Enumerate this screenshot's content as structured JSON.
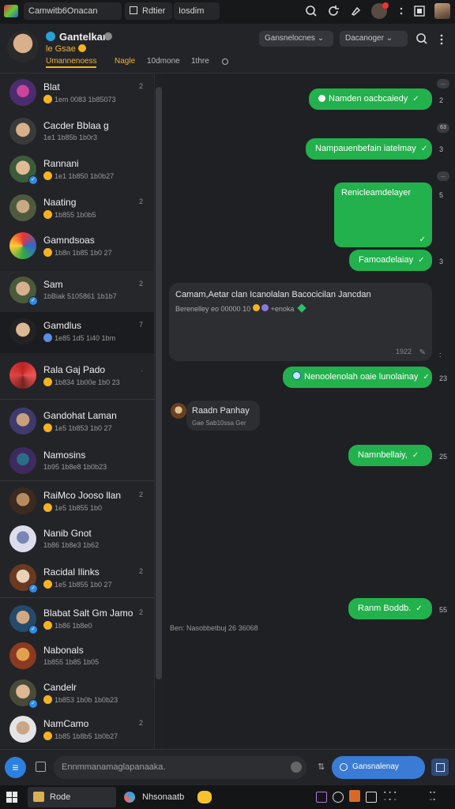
{
  "browser": {
    "tabs": [
      {
        "label": "Camwitb6Onacan"
      },
      {
        "label": "Rdtier"
      },
      {
        "label": "Iosdim"
      }
    ],
    "icons": [
      "search-icon",
      "refresh-icon",
      "pin-icon",
      "notification-icon",
      "more-icon",
      "window-icon"
    ]
  },
  "header": {
    "name": "Gantelkan",
    "status_emoji": "le Gsae",
    "subtabs": [
      "Umannenoess",
      "Nagle",
      "10dmone",
      "1thre"
    ],
    "pill1": "Gansnelocnes",
    "pill2": "Dacanoger"
  },
  "sidebar": {
    "chats": [
      {
        "name": "Blat",
        "preview": "1em  0083  1b85073",
        "time": "2"
      },
      {
        "name": "Cacder Bblaa g",
        "preview": "1e1  1b85b  1b0r3",
        "time": ""
      },
      {
        "name": "Rannani",
        "preview": "1e1  1b850  1b0b27",
        "time": ""
      },
      {
        "name": "Naating",
        "preview": "1b855  1b0b5",
        "time": "2"
      },
      {
        "name": "Gamndsoas",
        "preview": "1b8n 1b85 1b0 27",
        "time": ""
      },
      {
        "name": "Sam",
        "preview": "1bBiak 5105861  1b1b7",
        "time": "2"
      },
      {
        "name": "Gamdlus",
        "preview": "1e85  1d5 1i40  1bm",
        "time": "7"
      },
      {
        "name": "Rala Gaj Pado",
        "preview": "1b834  1b00e  1b0 23",
        "time": "."
      },
      {
        "name": "Gandohat Laman",
        "preview": "1e5   1b853  1b0 27",
        "time": ""
      },
      {
        "name": "Namosins",
        "preview": "1b95  1b8e8  1b0b23",
        "time": ""
      },
      {
        "name": "RaiMco Jooso llan",
        "preview": "1e5  1b855  1b0",
        "time": "2"
      },
      {
        "name": "Nanib Gnot",
        "preview": "1b86  1b8e3  1b62",
        "time": ""
      },
      {
        "name": "Racidal Ilinks",
        "preview": "1e5  1b855  1b0 27",
        "time": "2"
      },
      {
        "name": "Blabat Salt Gm Jamo",
        "preview": "1b86  1b8e0",
        "time": "2"
      },
      {
        "name": "Nabonals",
        "preview": "1b855  1b85  1b05",
        "time": ""
      },
      {
        "name": "Candelr",
        "preview": "1b853  1b0b  1b0b23",
        "time": ""
      },
      {
        "name": "NamCamo",
        "preview": "1b85  1b8b5  1b0b27",
        "time": "2"
      }
    ]
  },
  "messages": [
    {
      "text": "Namden oacbcaiedy",
      "time": "2"
    },
    {
      "text": "Nampauenbefain iatelmay",
      "time": "3"
    },
    {
      "text": "Renicleamdelayer",
      "time": "5"
    },
    {
      "text": "Famoadelaiay",
      "time": "3"
    },
    {
      "in_title": "Camam,Aetar clan  Icanolalan  Bacocicilan  Jancdan",
      "in_sub": "Berenelley eo 00000  10",
      "in_sub2": "+enoka",
      "in_time": "1922"
    },
    {
      "text": "Nenoolenolah oaie lunolainay",
      "time": "23"
    },
    {
      "sender": "Raadn Panhay",
      "sender_sub": "Gae  Sab10ssa  Ger"
    },
    {
      "text": "Namnbellaiy,",
      "time": "25"
    },
    {
      "text": "Ranm Boddb.",
      "time": "55"
    },
    {
      "system": "Ben: Nasobbetbuj 26 36068"
    }
  ],
  "side_badges": [
    "...",
    "63",
    "...",
    "...",
    "29",
    "29",
    "3"
  ],
  "composer": {
    "placeholder": "Ennmmanamaglapanaaka.",
    "send_label": "Gansnalenay"
  },
  "taskbar": {
    "items": [
      "Rode",
      "Nhsonaatb"
    ]
  },
  "colors": {
    "accent": "#22b14c",
    "send": "#3a7bd5",
    "tab_underline": "#f5b321"
  }
}
